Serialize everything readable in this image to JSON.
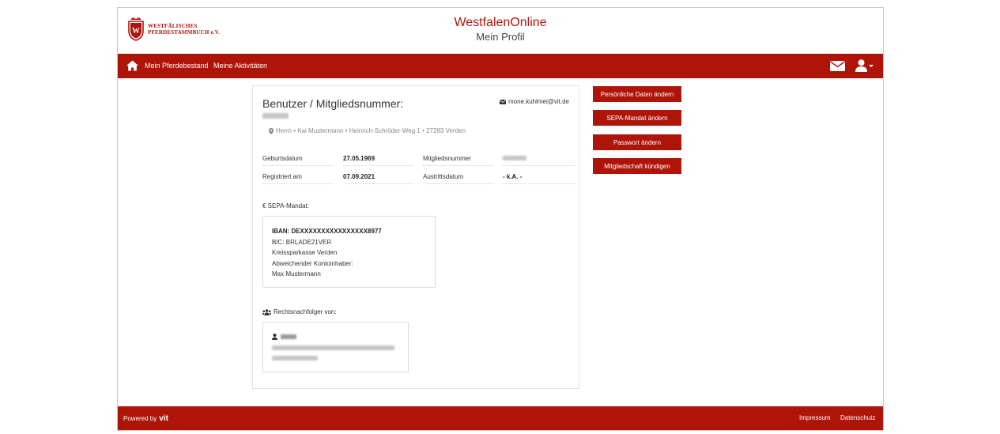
{
  "header": {
    "logo_line1": "WESTFÄLISCHES",
    "logo_line2": "PFERDESTAMMBUCH e.V.",
    "title": "WestfalenOnline",
    "subtitle": "Mein Profil"
  },
  "nav": {
    "items": [
      {
        "label": "Mein Pferdebestand"
      },
      {
        "label": "Meine Aktivitäten"
      }
    ]
  },
  "profile": {
    "title": "Benutzer / Mitgliedsnummer:",
    "email": "mone.kuhlmei@vit.de",
    "address": "Herrn • Kai Mustermann • Heinrich-Schröder-Weg 1 • 27283 Verden",
    "fields": {
      "birth_label": "Geburtsdatum",
      "birth_value": "27.05.1969",
      "member_label": "Mitgliedsnummer",
      "registered_label": "Registriert am",
      "registered_value": "07.09.2021",
      "exit_label": "Austrittsdatum",
      "exit_value": "- k.A. -"
    }
  },
  "sepa": {
    "title": "€ SEPA-Mandat:",
    "iban": "IBAN: DEXXXXXXXXXXXXXXXX8977",
    "bic": "BIC: BRLADE21VER",
    "bank": "Kreissparkasse Verden",
    "holder_label": "Abweichender Kontoinhaber:",
    "holder_name": "Max Mustermann"
  },
  "successor": {
    "title": "Rechtsnachfolger von:"
  },
  "actions": [
    {
      "label": "Persönliche Daten ändern"
    },
    {
      "label": "SEPA-Mandat ändern"
    },
    {
      "label": "Passwort ändern"
    },
    {
      "label": "Mitgliedschaft kündigen"
    }
  ],
  "footer": {
    "powered_by": "Powered by",
    "powered_brand": "vit",
    "impressum": "Impressum",
    "datenschutz": "Datenschutz"
  },
  "colors": {
    "brand_red": "#af1409",
    "text": "#333333"
  }
}
